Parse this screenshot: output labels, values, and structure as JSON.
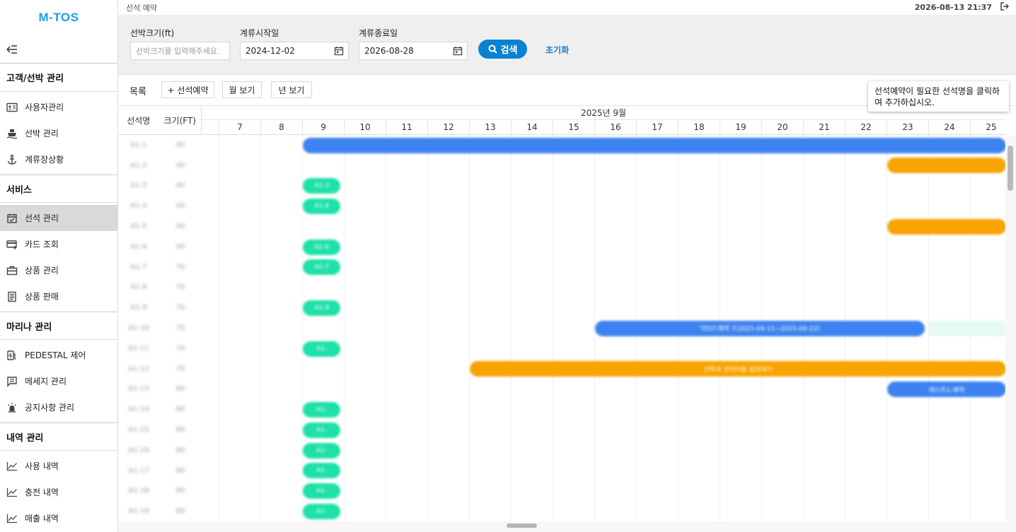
{
  "app": {
    "logo": "M-TOS"
  },
  "sidebar": {
    "sections": [
      {
        "title": "고객/선박 관리",
        "items": [
          {
            "label": "사용자관리",
            "icon": "id-card-icon"
          },
          {
            "label": "선박 관리",
            "icon": "ship-icon"
          },
          {
            "label": "계류장상황",
            "icon": "anchor-icon"
          }
        ]
      },
      {
        "title": "서비스",
        "items": [
          {
            "label": "선석 관리",
            "icon": "calendar-check-icon",
            "active": true
          },
          {
            "label": "카드 조회",
            "icon": "card-icon"
          },
          {
            "label": "상품 관리",
            "icon": "briefcase-icon"
          },
          {
            "label": "상품 판매",
            "icon": "receipt-icon"
          }
        ]
      },
      {
        "title": "마리나 관리",
        "items": [
          {
            "label": "PEDESTAL 제어",
            "icon": "charger-icon"
          },
          {
            "label": "메세지 관리",
            "icon": "message-icon"
          },
          {
            "label": "공지사항 관리",
            "icon": "alarm-icon"
          }
        ]
      },
      {
        "title": "내역 관리",
        "items": [
          {
            "label": "사용 내역",
            "icon": "chart-line-icon"
          },
          {
            "label": "충전 내역",
            "icon": "chart-line-icon"
          },
          {
            "label": "매출 내역",
            "icon": "chart-line-icon"
          }
        ]
      }
    ]
  },
  "header": {
    "breadcrumb": "선석 예약",
    "datetime": "2026-08-13 21:37"
  },
  "filter": {
    "size_label": "선박크기(ft)",
    "size_placeholder": "선박크기를 입력해주세요.",
    "start_label": "계류시작일",
    "start_value": "2024-12-02",
    "end_label": "계류종료일",
    "end_value": "2026-08-28",
    "search_label": "검색",
    "reset_label": "초기화"
  },
  "toolbar": {
    "list_label": "목록",
    "add_label": "+ 선석예약",
    "month_view_label": "월 보기",
    "year_view_label": "년 보기"
  },
  "tooltip": "선석예약이 필요한 선석명을 클릭하여 추가하십시오.",
  "grid": {
    "col_name": "선석명",
    "col_size": "크기(FT)",
    "month": "2025년 9월",
    "days": [
      "7",
      "8",
      "9",
      "10",
      "11",
      "12",
      "13",
      "14",
      "15",
      "16",
      "17",
      "18",
      "19",
      "20",
      "21",
      "22",
      "23",
      "24",
      "25"
    ],
    "rows": [
      {
        "name": "A1-1",
        "size": "40"
      },
      {
        "name": "A1-2",
        "size": "40"
      },
      {
        "name": "A1-3",
        "size": "40"
      },
      {
        "name": "A1-4",
        "size": "40"
      },
      {
        "name": "A1-5",
        "size": "40"
      },
      {
        "name": "A1-6",
        "size": "40"
      },
      {
        "name": "A1-7",
        "size": "70"
      },
      {
        "name": "A1-8",
        "size": "70"
      },
      {
        "name": "A1-9",
        "size": "70"
      },
      {
        "name": "A1-10",
        "size": "70"
      },
      {
        "name": "A1-11",
        "size": "70"
      },
      {
        "name": "A1-12",
        "size": "70"
      },
      {
        "name": "A1-13",
        "size": "80"
      },
      {
        "name": "A1-14",
        "size": "80"
      },
      {
        "name": "A1-15",
        "size": "80"
      },
      {
        "name": "A1-16",
        "size": "80"
      },
      {
        "name": "A1-17",
        "size": "80"
      },
      {
        "name": "A1-18",
        "size": "80"
      },
      {
        "name": "A1-19",
        "size": "80"
      }
    ],
    "bars": [
      {
        "row": 0,
        "start": 8,
        "end": 25.9,
        "color": "#3d82f0",
        "label": ""
      },
      {
        "row": 1,
        "start": 22,
        "end": 25.9,
        "color": "#f8a300",
        "label": ""
      },
      {
        "row": 2,
        "start": 8,
        "end": 8.9,
        "color": "#1ee0a8",
        "label": "A1-3"
      },
      {
        "row": 3,
        "start": 8,
        "end": 8.9,
        "color": "#1ee0a8",
        "label": "A1-4"
      },
      {
        "row": 4,
        "start": 22,
        "end": 25.9,
        "color": "#f8a300",
        "label": ""
      },
      {
        "row": 5,
        "start": 8,
        "end": 8.9,
        "color": "#1ee0a8",
        "label": "A1-6"
      },
      {
        "row": 6,
        "start": 8,
        "end": 8.9,
        "color": "#1ee0a8",
        "label": "A1-7"
      },
      {
        "row": 8,
        "start": 8,
        "end": 8.9,
        "color": "#1ee0a8",
        "label": "A1-9"
      },
      {
        "row": 9,
        "start": 15,
        "end": 22.9,
        "color": "#3d82f0",
        "label": "TEST-예약 7(2025-09-15~2025-09-22)"
      },
      {
        "row": 9,
        "start": 23,
        "end": 24.9,
        "color": "#e6faf4",
        "label": ""
      },
      {
        "row": 9,
        "start": 25,
        "end": 25.9,
        "color": "#f8a300",
        "label": ""
      },
      {
        "row": 10,
        "start": 8,
        "end": 8.9,
        "color": "#1ee0a8",
        "label": "A1-"
      },
      {
        "row": 11,
        "start": 12,
        "end": 25.9,
        "color": "#f8a300",
        "label": "선박서 선석이용 심의대기"
      },
      {
        "row": 12,
        "start": 22,
        "end": 25.9,
        "color": "#3d82f0",
        "label": "테스트1-예약"
      },
      {
        "row": 13,
        "start": 8,
        "end": 8.9,
        "color": "#1ee0a8",
        "label": "A1-"
      },
      {
        "row": 14,
        "start": 8,
        "end": 8.9,
        "color": "#1ee0a8",
        "label": "A1-"
      },
      {
        "row": 15,
        "start": 8,
        "end": 8.9,
        "color": "#1ee0a8",
        "label": "A1-"
      },
      {
        "row": 16,
        "start": 8,
        "end": 8.9,
        "color": "#1ee0a8",
        "label": "A1-"
      },
      {
        "row": 17,
        "start": 8,
        "end": 8.9,
        "color": "#1ee0a8",
        "label": "A1-"
      },
      {
        "row": 18,
        "start": 8,
        "end": 8.9,
        "color": "#1ee0a8",
        "label": "A1-"
      }
    ]
  }
}
